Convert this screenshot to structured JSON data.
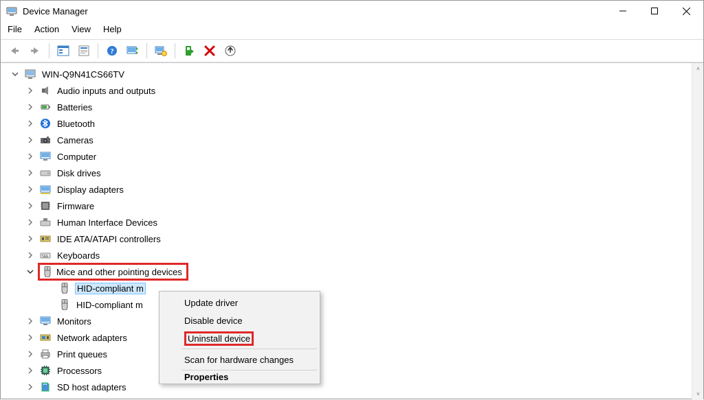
{
  "window": {
    "title": "Device Manager"
  },
  "menu": {
    "file": "File",
    "action": "Action",
    "view": "View",
    "help": "Help"
  },
  "toolbar_icons": {
    "back": "back-arrow-icon",
    "forward": "forward-arrow-icon",
    "show_hidden": "show-hidden-icon",
    "properties": "properties-sheet-icon",
    "help": "help-icon",
    "refresh": "refresh-icon",
    "monitor": "remote-computer-icon",
    "scan": "scan-hardware-icon",
    "remove": "remove-icon",
    "update": "update-driver-icon"
  },
  "tree": {
    "root": "WIN-Q9N41CS66TV",
    "categories": [
      {
        "label": "Audio inputs and outputs",
        "icon": "speaker-icon",
        "expanded": false
      },
      {
        "label": "Batteries",
        "icon": "battery-icon",
        "expanded": false
      },
      {
        "label": "Bluetooth",
        "icon": "bluetooth-icon",
        "expanded": false
      },
      {
        "label": "Cameras",
        "icon": "camera-icon",
        "expanded": false
      },
      {
        "label": "Computer",
        "icon": "computer-icon",
        "expanded": false
      },
      {
        "label": "Disk drives",
        "icon": "disk-drive-icon",
        "expanded": false
      },
      {
        "label": "Display adapters",
        "icon": "display-adapter-icon",
        "expanded": false
      },
      {
        "label": "Firmware",
        "icon": "firmware-icon",
        "expanded": false
      },
      {
        "label": "Human Interface Devices",
        "icon": "hid-icon",
        "expanded": false
      },
      {
        "label": "IDE ATA/ATAPI controllers",
        "icon": "ide-controller-icon",
        "expanded": false
      },
      {
        "label": "Keyboards",
        "icon": "keyboard-icon",
        "expanded": false
      },
      {
        "label": "Mice and other pointing devices",
        "icon": "mouse-icon",
        "expanded": true,
        "highlighted": true,
        "children": [
          {
            "label": "HID-compliant mouse",
            "icon": "mouse-icon",
            "selected": true,
            "truncated_by_menu": "HID-compliant m"
          },
          {
            "label": "HID-compliant mouse",
            "icon": "mouse-icon",
            "truncated_by_menu": "HID-compliant m"
          }
        ]
      },
      {
        "label": "Monitors",
        "icon": "monitor-icon",
        "expanded": false
      },
      {
        "label": "Network adapters",
        "icon": "network-adapter-icon",
        "expanded": false
      },
      {
        "label": "Print queues",
        "icon": "printer-icon",
        "expanded": false
      },
      {
        "label": "Processors",
        "icon": "processor-icon",
        "expanded": false
      },
      {
        "label": "SD host adapters",
        "icon": "sd-host-icon",
        "expanded": false
      }
    ]
  },
  "context_menu": {
    "items": [
      {
        "label": "Update driver",
        "type": "item"
      },
      {
        "label": "Disable device",
        "type": "item"
      },
      {
        "label": "Uninstall device",
        "type": "item",
        "highlighted": true
      },
      {
        "type": "sep"
      },
      {
        "label": "Scan for hardware changes",
        "type": "item"
      },
      {
        "type": "sep"
      },
      {
        "label": "Properties",
        "type": "item",
        "bold": true,
        "cutoff": true
      }
    ]
  }
}
